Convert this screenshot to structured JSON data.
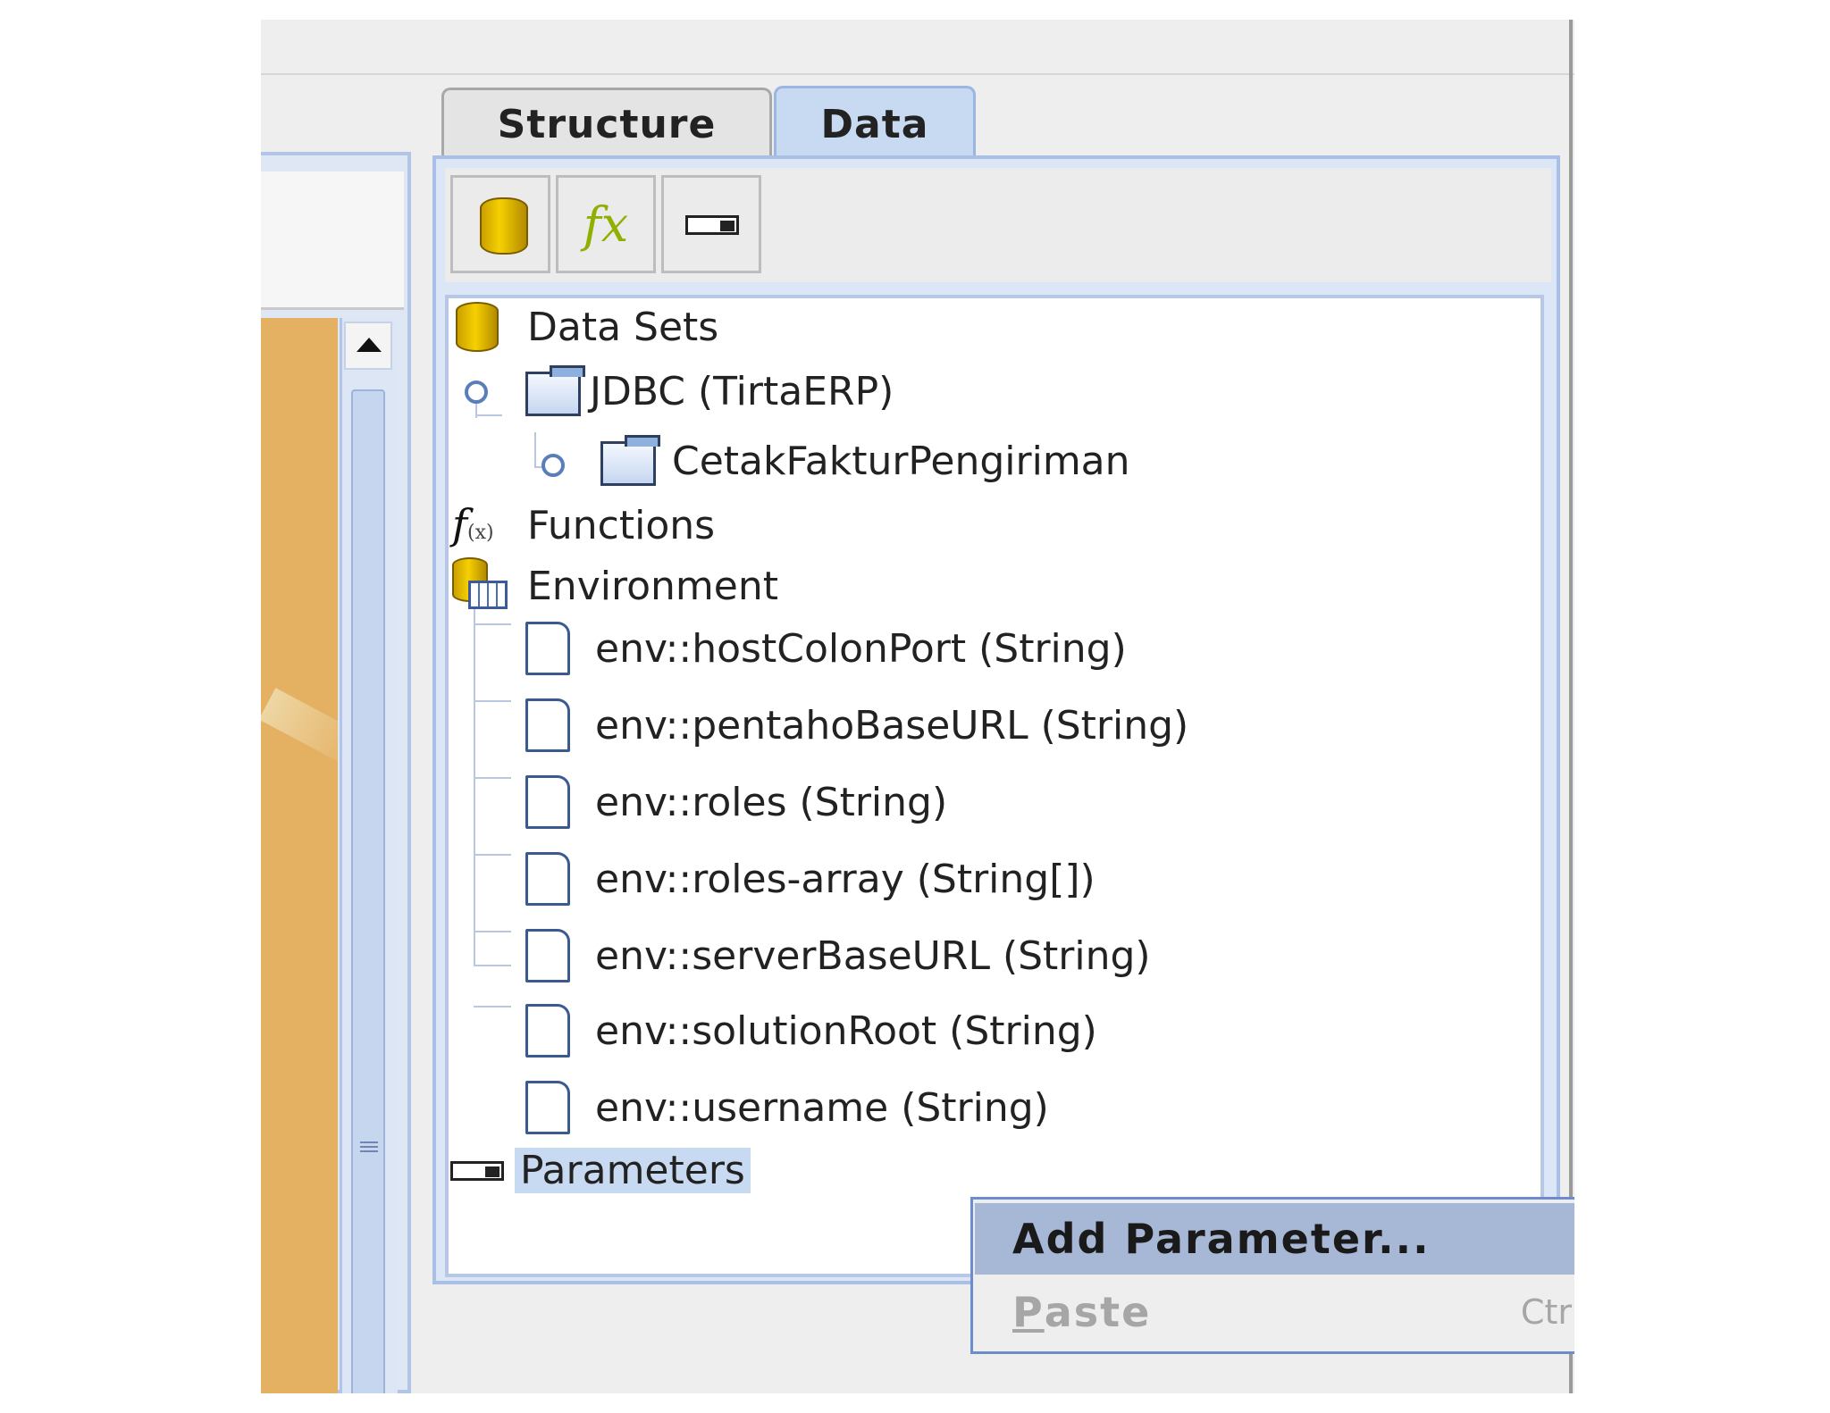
{
  "tabs": [
    {
      "label": "Structure",
      "selected": false
    },
    {
      "label": "Data",
      "selected": true
    }
  ],
  "toolbar": {
    "buttons": [
      {
        "icon": "database-icon"
      },
      {
        "icon": "function-icon",
        "glyph": "fx"
      },
      {
        "icon": "parameter-icon"
      }
    ]
  },
  "tree": {
    "data_sets": {
      "label": "Data Sets",
      "connection": "JDBC (TirtaERP)",
      "query": "CetakFakturPengiriman"
    },
    "functions": {
      "label": "Functions",
      "icon_text": "f",
      "icon_sub": "(x)"
    },
    "environment": {
      "label": "Environment",
      "items": [
        "env::hostColonPort (String)",
        "env::pentahoBaseURL (String)",
        "env::roles (String)",
        "env::roles-array (String[])",
        "env::serverBaseURL (String)",
        "env::solutionRoot (String)",
        "env::username (String)"
      ]
    },
    "parameters": {
      "label": "Parameters",
      "selected": true
    }
  },
  "context_menu": {
    "items": [
      {
        "label": "Add Parameter...",
        "highlighted": true,
        "enabled": true
      },
      {
        "label": "Paste",
        "mnemonic": "P",
        "rest": "aste",
        "shortcut": "Ctrl-V",
        "enabled": false
      }
    ]
  },
  "colors": {
    "accent": "#c8d9f2",
    "border": "#a9bfe6",
    "menu_highlight": "#a7b8d6",
    "canvas": "#e4b062"
  }
}
